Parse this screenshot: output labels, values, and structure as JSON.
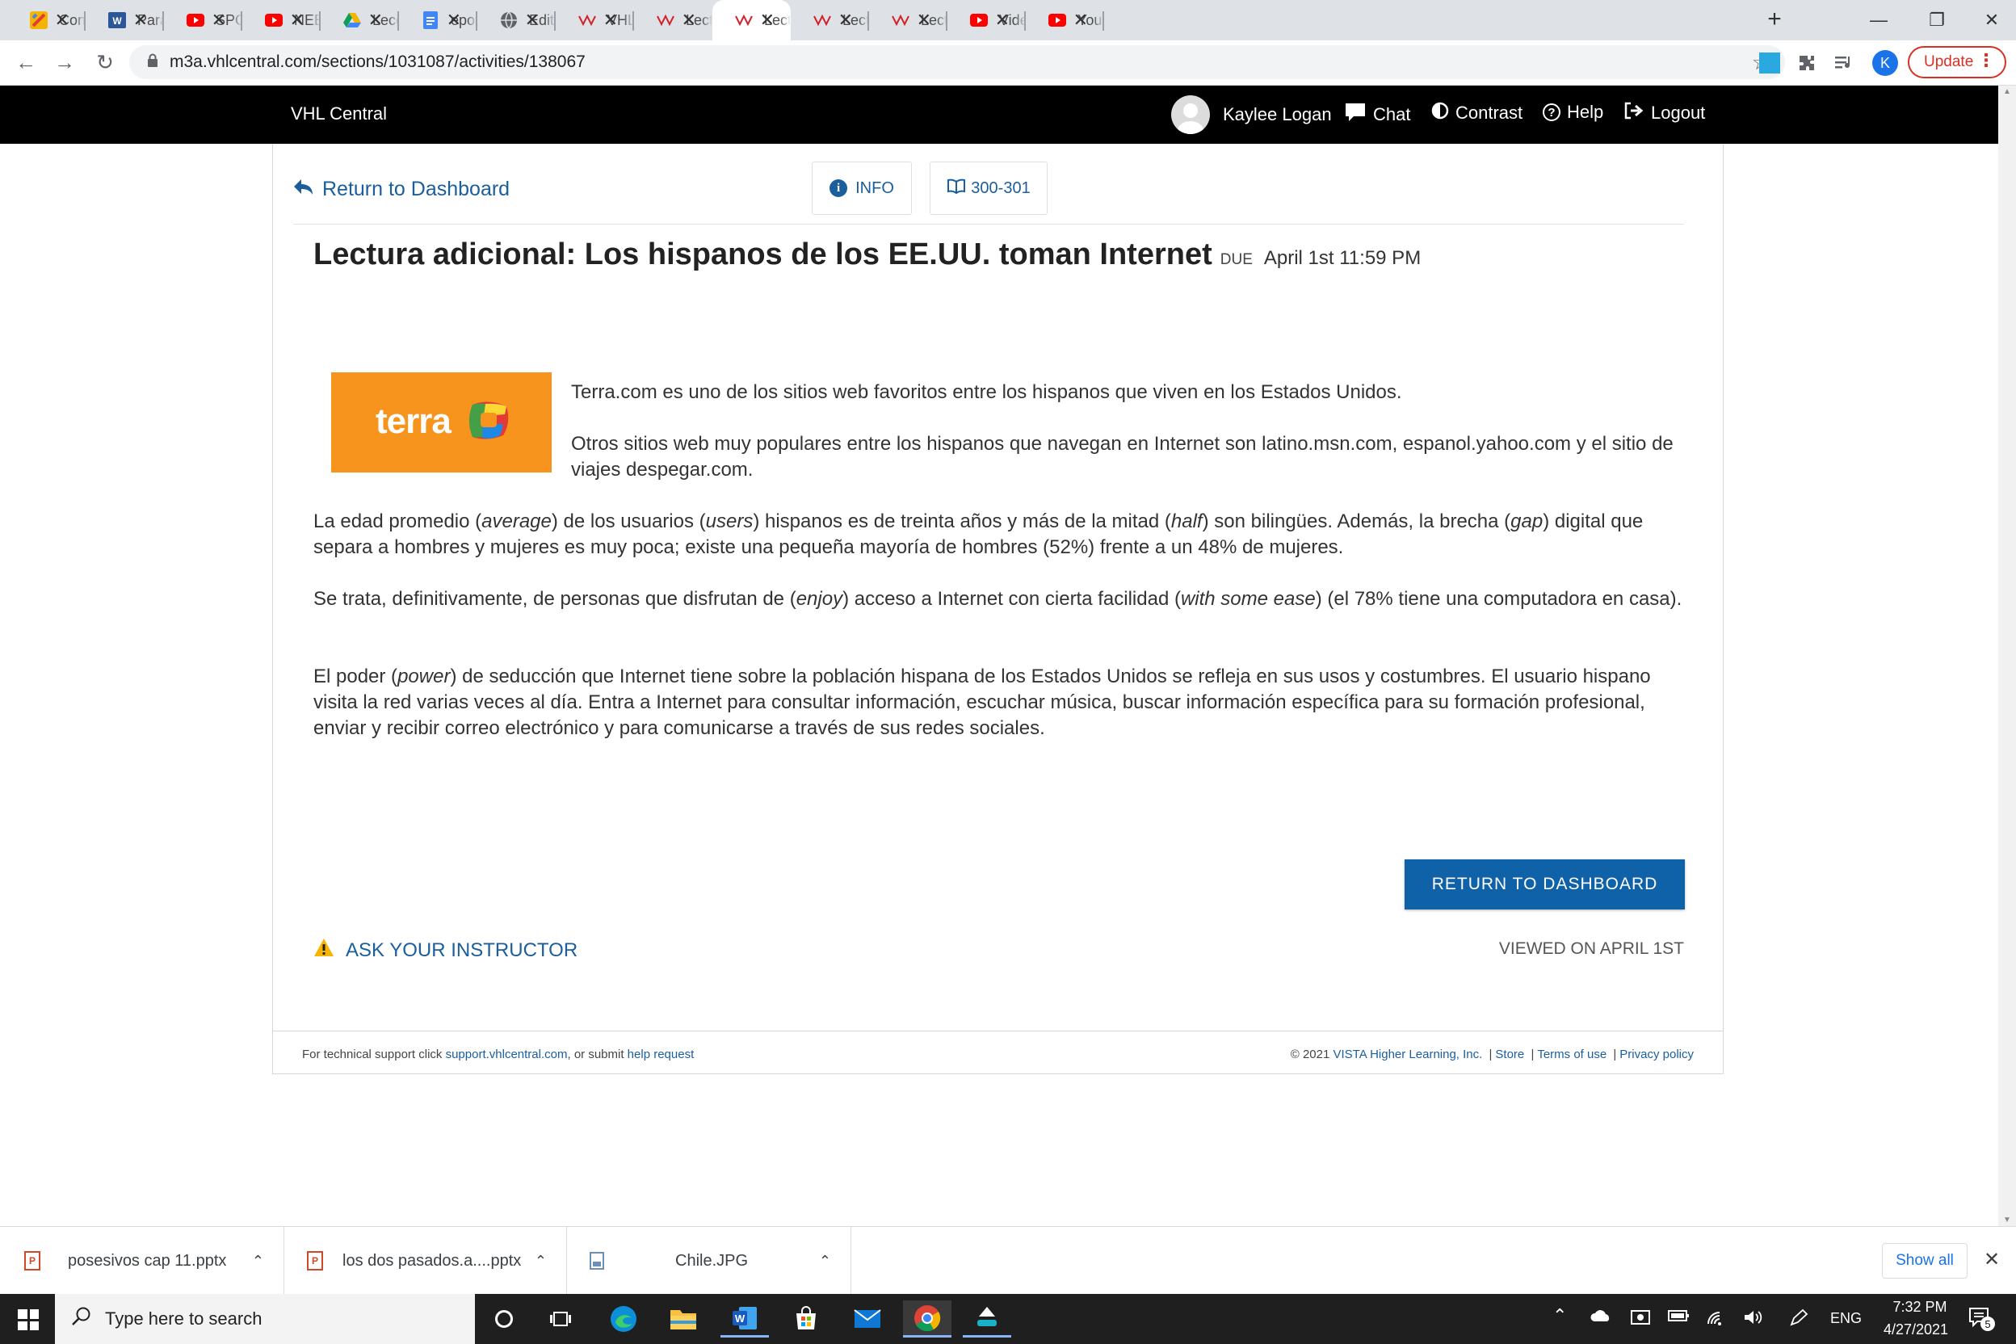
{
  "browser": {
    "tabs": [
      {
        "title": "Content",
        "icon": "colorful-doc-icon",
        "color": "#f4b400"
      },
      {
        "title": "Para el",
        "icon": "word-icon",
        "color": "#2b579a"
      },
      {
        "title": "SPOT Ti",
        "icon": "youtube-icon",
        "color": "#ff0000"
      },
      {
        "title": "NEEM ",
        "icon": "youtube-icon",
        "color": "#ff0000"
      },
      {
        "title": "Leccion",
        "icon": "google-drive-icon",
        "color": "#0f9d58"
      },
      {
        "title": "eportfo",
        "icon": "google-docs-icon",
        "color": "#4285f4"
      },
      {
        "title": "Edit Pa",
        "icon": "globe-icon",
        "color": "#5f6368"
      },
      {
        "title": "VHL Ce",
        "icon": "vhl-icon",
        "color": "#d2232a"
      },
      {
        "title": "Lectura",
        "icon": "vhl-icon",
        "color": "#d2232a"
      },
      {
        "title": "Lectura",
        "icon": "vhl-icon",
        "color": "#d2232a"
      },
      {
        "title": "Lectura",
        "icon": "vhl-icon",
        "color": "#d2232a"
      },
      {
        "title": "Lectura",
        "icon": "vhl-icon",
        "color": "#d2232a"
      },
      {
        "title": "Video ",
        "icon": "youtube-icon",
        "color": "#ff0000"
      },
      {
        "title": "YouTub",
        "icon": "youtube-icon",
        "color": "#ff0000"
      }
    ],
    "active_tab_index": 9,
    "url": "m3a.vhlcentral.com/sections/1031087/activities/138067",
    "profile_initial": "K",
    "update_label": "Update"
  },
  "header": {
    "brand": "VHL Central",
    "user_name": "Kaylee Logan",
    "chat": "Chat",
    "contrast": "Contrast",
    "help": "Help",
    "logout": "Logout"
  },
  "nav": {
    "return_link": "Return to Dashboard",
    "info": "INFO",
    "pages": "300-301"
  },
  "activity": {
    "title": "Lectura adicional: Los hispanos de los EE.UU. toman Internet",
    "due_label": "DUE",
    "due_date": "April 1st 11:59 PM",
    "logo_text": "terra",
    "para1": "Terra.com es uno de los sitios web favoritos entre los hispanos que viven en los Estados Unidos.",
    "para2": "Otros sitios web muy populares entre los hispanos que navegan en Internet son latino.msn.com, espanol.yahoo.com y el sitio de viajes despegar.com.",
    "para3": {
      "t1": "La edad promedio (",
      "i1": "average",
      "t2": ") de los usuarios (",
      "i2": "users",
      "t3": ") hispanos es de treinta años y más de la mitad (",
      "i3": "half",
      "t4": ") son bilingües. Además, la brecha (",
      "i4": "gap",
      "t5": ") digital que separa a hombres y mujeres es muy poca; existe una pequeña mayoría de hombres (52%) frente a un 48% de mujeres."
    },
    "para4": {
      "t1": "Se trata, definitivamente, de personas que disfrutan de (",
      "i1": "enjoy",
      "t2": ") acceso a Internet con cierta facilidad (",
      "i2": "with some ease",
      "t3": ") (el 78% tiene una computadora en casa)."
    },
    "para5": {
      "t1": "El poder (",
      "i1": "power",
      "t2": ") de seducción que Internet tiene sobre la población hispana de los Estados Unidos se refleja en sus usos y costumbres. El usuario hispano visita la red varias veces al día. Entra a Internet para consultar información, escuchar música, buscar información específica para su formación profesional, enviar y recibir correo electrónico y para comunicarse a través de sus redes sociales."
    },
    "return_button": "RETURN TO DASHBOARD",
    "ask_instructor": "ASK YOUR INSTRUCTOR",
    "viewed": "VIEWED ON APRIL 1ST"
  },
  "footer": {
    "support_prefix": "For technical support click ",
    "support_link": "support.vhlcentral.com",
    "support_mid": ", or submit ",
    "help_request": "help request",
    "copyright": "© 2021 ",
    "company": "VISTA Higher Learning, Inc.",
    "store": "Store",
    "terms": "Terms of use",
    "privacy": "Privacy policy",
    "sep": "|"
  },
  "downloads": {
    "items": [
      {
        "name": "posesivos cap 11.pptx",
        "icon": "powerpoint-icon"
      },
      {
        "name": "los dos pasados.a....pptx",
        "icon": "powerpoint-icon"
      },
      {
        "name": "Chile.JPG",
        "icon": "image-file-icon"
      }
    ],
    "show_all": "Show all"
  },
  "taskbar": {
    "search_placeholder": "Type here to search",
    "language": "ENG",
    "time": "7:32 PM",
    "date": "4/27/2021",
    "notifications": "5"
  },
  "colors": {
    "link": "#1a5e9c",
    "button": "#0f61a8",
    "terra_orange": "#f7941d",
    "header": "#000000"
  }
}
